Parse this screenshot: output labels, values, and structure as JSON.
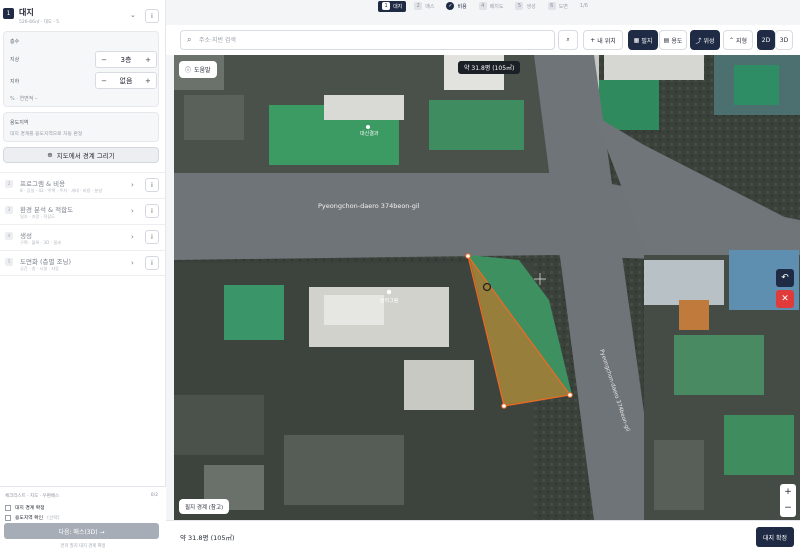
{
  "stepper": {
    "steps": [
      {
        "num": "1",
        "label": "대지"
      },
      {
        "num": "2",
        "label": "매스"
      },
      {
        "num": "✓",
        "label": "비용"
      },
      {
        "num": "4",
        "label": "배치도"
      },
      {
        "num": "5",
        "label": "생성"
      },
      {
        "num": "6",
        "label": "도면"
      }
    ],
    "counter": "1/6"
  },
  "site_card": {
    "num": "1",
    "title": "대지",
    "subtitle": "526-66㎡ · 대도 · 5"
  },
  "floors": {
    "section_label": "층수",
    "above_label": "지상",
    "above_value": "3층",
    "below_label": "지하",
    "below_value": "없음",
    "area_label": "% · 연면적 –"
  },
  "zoning": {
    "title": "용도지역",
    "desc": "대지 경계를 용도지역으로 자동 판정"
  },
  "draw_button": "지도에서 경계 그리기",
  "sections": [
    {
      "num": "2",
      "title": "프로그램 & 비용",
      "sub": "8 · 공실 · 42 · 주택 · 주차 · 세대 · 비용 · 분양"
    },
    {
      "num": "3",
      "title": "환경 분석 & 적합도",
      "sub": "일조 · 조망 · 적합도"
    },
    {
      "num": "4",
      "title": "생성",
      "sub": "구획 · 블록 · 3D · 결과"
    },
    {
      "num": "5",
      "title": "도면화 (층별 조닝)",
      "sub": "공간 · 층 · 시설 · 자동"
    }
  ],
  "checklist": {
    "title": "체크리스트 · 지도 · 우편배스",
    "count": "0/2",
    "items": [
      {
        "label": "대지 경계 확정",
        "note": ""
      },
      {
        "label": "용도지역 확인",
        "note": "(선택)"
      }
    ],
    "next_button": "다음: 매스(3D) →",
    "hint": "먼저 필지 대지 경계 확정"
  },
  "toolbar": {
    "search_placeholder": "주소·지번 검색",
    "my_location": "내 위치",
    "parcel": "필지",
    "use": "용도",
    "satellite": "위성",
    "terrain": "지형",
    "mode_2d": "2D",
    "mode_3d": "3D"
  },
  "map": {
    "help": "도움말",
    "area_pill": "약 31.8평 (105㎡)",
    "road_label": "Pyeongchon-daero 374beon-gil",
    "road_label_2": "Pyeongchon-daero 374beon-gil",
    "poi_1": "대신결과",
    "poi_2": "올라그림",
    "boundary_pill": "필지 경계 (참고)"
  },
  "bottom": {
    "area": "약 31.8평 (105㎡)",
    "confirm": "대지 확정"
  }
}
